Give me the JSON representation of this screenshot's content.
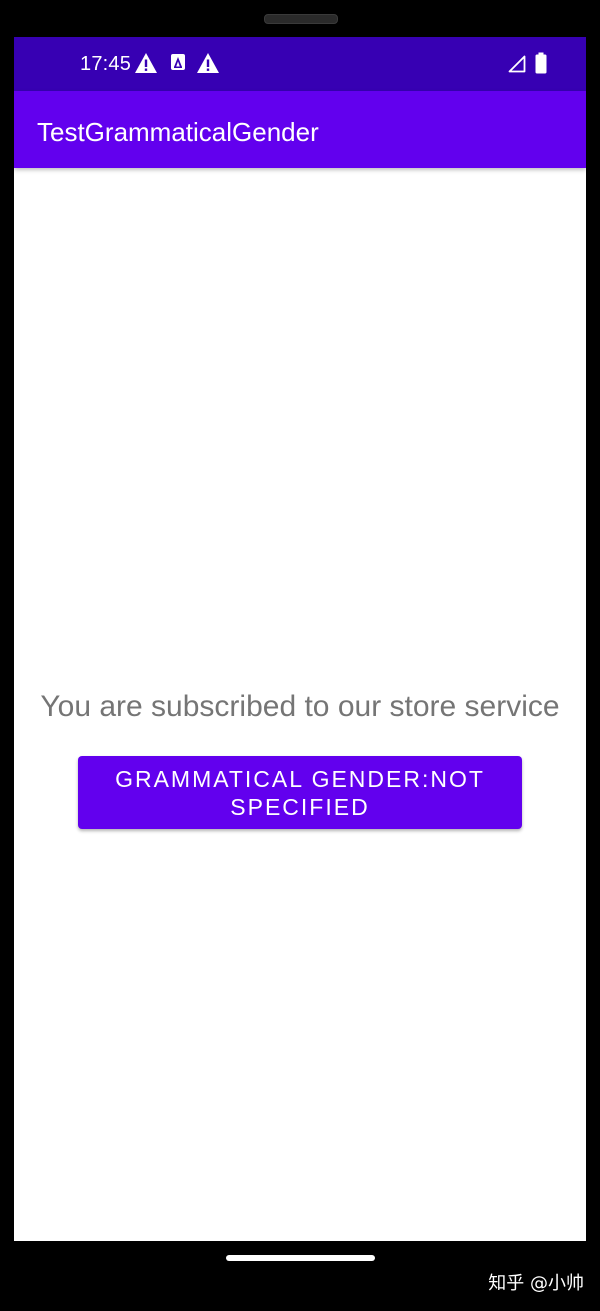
{
  "status_bar": {
    "time": "17:45",
    "left_icons": [
      "warning-icon",
      "app-notification-icon",
      "warning-icon"
    ],
    "right_icons": [
      "signal-icon",
      "battery-icon"
    ],
    "background_color": "#3700b3"
  },
  "app_bar": {
    "title": "TestGrammaticalGender",
    "background_color": "#6200ee"
  },
  "content": {
    "message": "You are subscribed to our store service",
    "button_label": "GRAMMATICAL GENDER:NOT SPECIFIED",
    "button_color": "#6200ee",
    "text_color": "#757575"
  },
  "watermark": {
    "text": "知乎 @小帅"
  }
}
